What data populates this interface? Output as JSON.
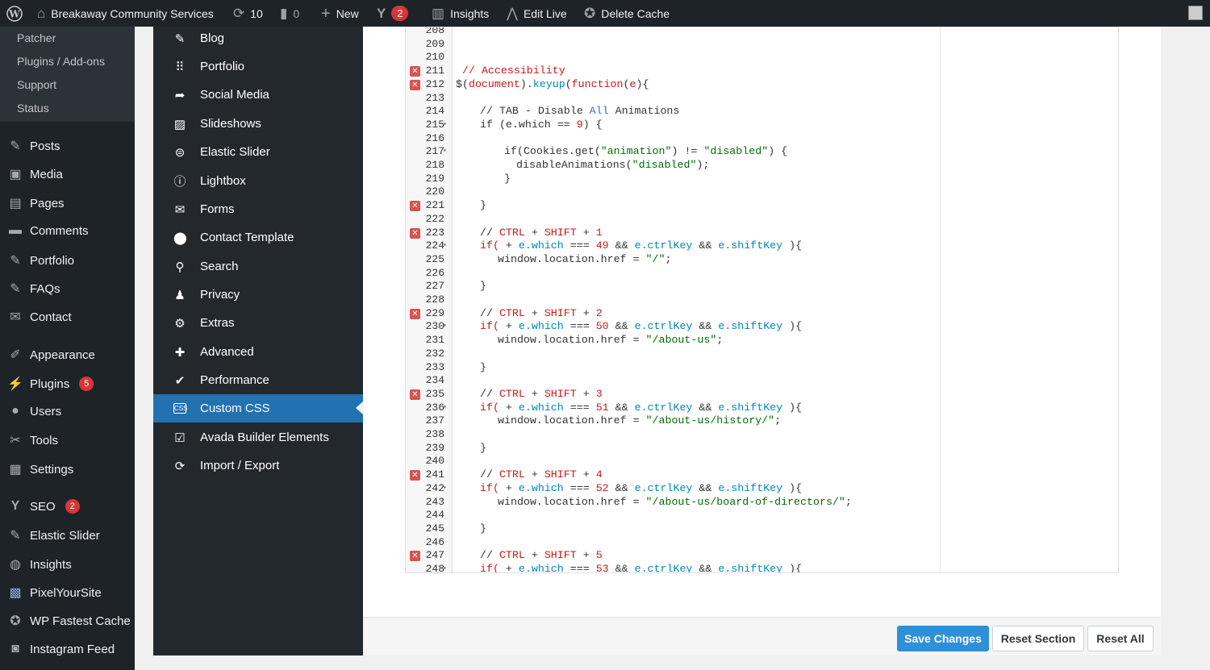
{
  "adminbar": {
    "site_name": "Breakaway Community Services",
    "updates_count": "10",
    "comments_count": "0",
    "new_label": "New",
    "yoast_badge": "2",
    "insights_label": "Insights",
    "edit_live_label": "Edit Live",
    "delete_cache_label": "Delete Cache"
  },
  "submenu": [
    "Patcher",
    "Plugins / Add-ons",
    "Support",
    "Status"
  ],
  "sidebar": {
    "posts": "Posts",
    "media": "Media",
    "pages": "Pages",
    "comments": "Comments",
    "portfolio": "Portfolio",
    "faqs": "FAQs",
    "contact": "Contact",
    "appearance": "Appearance",
    "plugins": "Plugins",
    "plugins_badge": "5",
    "users": "Users",
    "tools": "Tools",
    "settings": "Settings",
    "seo": "SEO",
    "seo_badge": "2",
    "elastic_slider": "Elastic Slider",
    "insights": "Insights",
    "pixelyoursite": "PixelYourSite",
    "wp_fastest_cache": "WP Fastest Cache",
    "instagram_feed": "Instagram Feed"
  },
  "panel": {
    "blog": "Blog",
    "portfolio": "Portfolio",
    "social_media": "Social Media",
    "slideshows": "Slideshows",
    "elastic_slider": "Elastic Slider",
    "lightbox": "Lightbox",
    "forms": "Forms",
    "contact_template": "Contact Template",
    "search": "Search",
    "privacy": "Privacy",
    "extras": "Extras",
    "advanced": "Advanced",
    "performance": "Performance",
    "custom_css": "Custom CSS",
    "builder_elements": "Avada Builder Elements",
    "import_export": "Import / Export",
    "css_icon_text": "CSS"
  },
  "editor": {
    "line_numbers": [
      "208",
      "209",
      "210",
      "211",
      "212",
      "213",
      "214",
      "215",
      "216",
      "217",
      "218",
      "219",
      "220",
      "221",
      "222",
      "223",
      "224",
      "225",
      "226",
      "227",
      "228",
      "229",
      "230",
      "231",
      "232",
      "233",
      "234",
      "235",
      "236",
      "237",
      "238",
      "239",
      "240",
      "241",
      "242",
      "243",
      "244",
      "245",
      "246",
      "247",
      "248"
    ],
    "error_lines": [
      "211",
      "212",
      "221",
      "223",
      "229",
      "235",
      "241",
      "247"
    ],
    "fold_lines": [
      "215",
      "217",
      "224",
      "230",
      "236",
      "242",
      "248"
    ],
    "code": {
      "c211": "// Accessibility",
      "c212_a": "$(",
      "c212_b": "document",
      "c212_c": ").",
      "c212_d": "keyup",
      "c212_e": "(",
      "c212_f": "function",
      "c212_g": "(",
      "c212_h": "e",
      "c212_i": "){",
      "c214_a": "// TAB - Disable ",
      "c214_b": "All",
      "c214_c": " Animations",
      "c215_a": "if (e.which == ",
      "c215_b": "9",
      "c215_c": ") {",
      "c217_a": "if(Cookies.get(",
      "c217_b": "\"animation\"",
      "c217_c": ") != ",
      "c217_d": "\"disabled\"",
      "c217_e": ") {",
      "c218_a": "disableAnimations(",
      "c218_b": "\"disabled\"",
      "c218_c": ");",
      "c219": "}",
      "c221": "}",
      "c_ctrl": "CTRL",
      "c_plus": " + ",
      "c_shift": "SHIFT",
      "c_slash": "// ",
      "c_if": "if(",
      "c_e": "e",
      "c_which": ".which",
      "c_eq": " === ",
      "c_and": " && ",
      "c_ctrlkey": ".ctrlKey",
      "c_shiftkey": ".shiftKey",
      "c_close": " ){",
      "c_href": "window.location.href = ",
      "c_semi": ";",
      "c_brace": "}",
      "n1": "1",
      "n2": "2",
      "n3": "3",
      "n4": "4",
      "n5": "5",
      "w1": "49",
      "w2": "50",
      "w3": "51",
      "w4": "52",
      "w5": "53",
      "s1": "\"/\"",
      "s2": "\"/about-us\"",
      "s3": "\"/about-us/history/\"",
      "s4": "\"/about-us/board-of-directors/\""
    }
  },
  "footer": {
    "save_label": "Save Changes",
    "reset_section_label": "Reset Section",
    "reset_all_label": "Reset All"
  }
}
